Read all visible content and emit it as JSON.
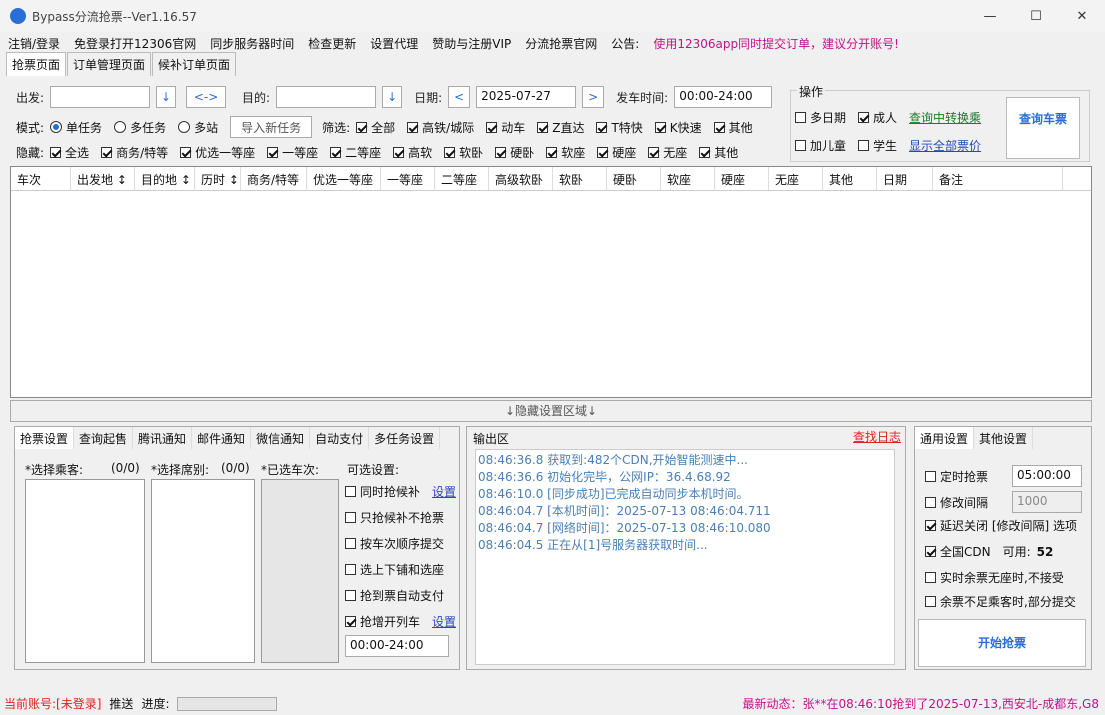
{
  "title": "Bypass分流抢票--Ver1.16.57",
  "win": [
    "—",
    "☐",
    "✕"
  ],
  "menu": [
    "注销/登录",
    "免登录打开12306官网",
    "同步服务器时间",
    "检查更新",
    "设置代理",
    "赞助与注册VIP",
    "分流抢票官网",
    "公告:"
  ],
  "notice": "使用12306app同时提交订单，建议分开账号!",
  "tabs": [
    "抢票页面",
    "订单管理页面",
    "候补订单页面"
  ],
  "from_label": "出发:",
  "to_label": "目的:",
  "date_label": "日期:",
  "date": "2025-07-27",
  "dep_label": "发车时间:",
  "dep_time": "00:00-24:00",
  "swap": "<->",
  "prev": "<",
  "next": ">",
  "down": "↓",
  "mode_label": "模式:",
  "modes": [
    "单任务",
    "多任务",
    "多站"
  ],
  "import": "导入新任务",
  "filter_label": "筛选:",
  "filters": [
    "全部",
    "高铁/城际",
    "动车",
    "Z直达",
    "T特快",
    "K快速",
    "其他"
  ],
  "hide_label": "隐藏:",
  "hides": [
    "全选",
    "商务/特等",
    "优选一等座",
    "一等座",
    "二等座",
    "高软",
    "软卧",
    "硬卧",
    "软座",
    "硬座",
    "无座",
    "其他"
  ],
  "ops": {
    "title": "操作",
    "multi": "多日期",
    "adult": "成人",
    "child": "加儿童",
    "student": "学生",
    "transfer": "查询中转换乘",
    "showall": "显示全部票价",
    "query": "查询车票"
  },
  "columns": [
    "车次",
    "出发地 ↕",
    "目的地 ↕",
    "历时 ↕",
    "商务/特等",
    "优选一等座",
    "一等座",
    "二等座",
    "高级软卧",
    "软卧",
    "硬卧",
    "软座",
    "硬座",
    "无座",
    "其他",
    "日期",
    "备注"
  ],
  "divider": "↓隐藏设置区域↓",
  "btabs": [
    "抢票设置",
    "查询起售",
    "腾讯通知",
    "邮件通知",
    "微信通知",
    "自动支付",
    "多任务设置"
  ],
  "passenger": "*选择乘客:",
  "passenger_count": "(0/0)",
  "seat": "*选择席别:",
  "seat_count": "(0/0)",
  "train": "*已选车次:",
  "opt_title": "可选设置:",
  "opts": [
    "同时抢候补",
    "只抢候补不抢票",
    "按车次顺序提交",
    "选上下铺和选座",
    "抢到票自动支付",
    "抢增开列车"
  ],
  "setting": "设置",
  "opt_time": "00:00-24:00",
  "out_title": "输出区",
  "findlog": "查找日志",
  "logs": [
    "08:46:36.8  获取到:482个CDN,开始智能测速中...",
    "08:46:36.6  初始化完毕，公网IP：36.4.68.92",
    "08:46:10.0  [同步成功]已完成自动同步本机时间。",
    "08:46:04.7  [本机时间]：2025-07-13 08:46:04.711",
    "08:46:04.7  [网络时间]：2025-07-13 08:46:10.080",
    "08:46:04.5  正在从[1]号服务器获取时间..."
  ],
  "gtabs": [
    "通用设置",
    "其他设置"
  ],
  "timed": "定时抢票",
  "timed_val": "05:00:00",
  "interval": "修改间隔",
  "interval_val": "1000",
  "delay": "延迟关闭 [修改间隔] 选项",
  "cdn": "全国CDN",
  "cdn_avail": "可用:",
  "cdn_count": "52",
  "nostanding": "实时余票无座时,不接受",
  "partial": "余票不足乘客时,部分提交",
  "start": "开始抢票",
  "account": "当前账号:[未登录]",
  "push": "推送",
  "progress": "进度:",
  "news": "最新动态：张**在08:46:10抢到了2025-07-13,西安北-成都东,G8"
}
